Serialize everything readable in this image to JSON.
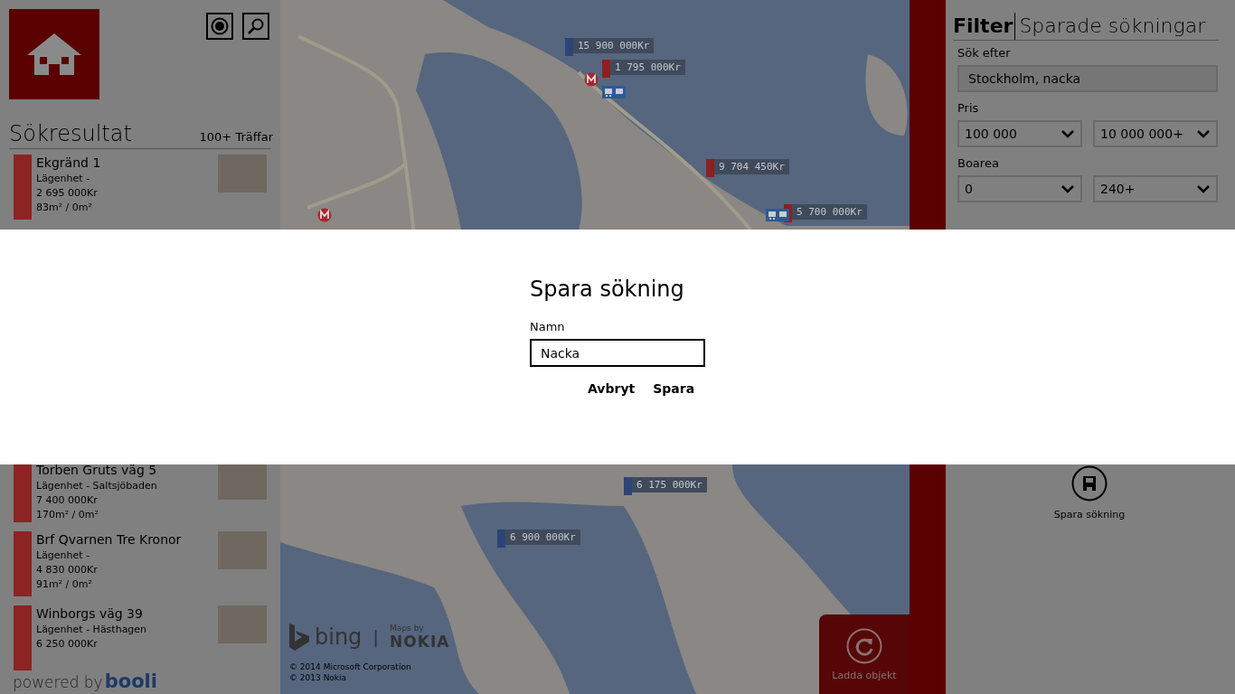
{
  "header": {
    "section_title": "Sökresultat",
    "hit_count": "100+ Träffar"
  },
  "results": [
    {
      "title": "Ekgränd 1",
      "type": "Lägenhet -",
      "price": "2 695 000Kr",
      "area": "83m² / 0m²"
    },
    {
      "title": "Torben Gruts väg 5",
      "type": "Lägenhet - Saltsjöbaden",
      "price": "7 400 000Kr",
      "area": "170m² / 0m²"
    },
    {
      "title": "Brf Qvarnen Tre Kronor",
      "type": "Lägenhet -",
      "price": "4 830 000Kr",
      "area": "91m² / 0m²"
    },
    {
      "title": "Winborgs väg 39",
      "type": "Lägenhet - Hästhagen",
      "price": "6 250 000Kr"
    }
  ],
  "footer": {
    "powered_by": "powered by",
    "brand": "booli"
  },
  "map": {
    "pins": [
      {
        "price": "15 900 000Kr",
        "color": "#2c4576"
      },
      {
        "price": "1 795 000Kr",
        "color": "#8c2020"
      },
      {
        "price": "9 704 450Kr",
        "color": "#8c2020"
      },
      {
        "price": "5 700 000Kr",
        "color": "#8c2020"
      },
      {
        "price": "6 175 000Kr",
        "color": "#2c4576"
      },
      {
        "price": "6 900 000Kr",
        "color": "#2c4576"
      }
    ],
    "logo": "bing",
    "separator": "|",
    "maps_by": "Maps by",
    "provider": "NOKIA",
    "copyright": [
      "© 2014 Microsoft Corporation",
      "© 2013 Nokia"
    ]
  },
  "load_button": {
    "label": "Ladda objekt"
  },
  "filter_panel": {
    "tabs": [
      {
        "label": "Filter",
        "selected": true
      },
      {
        "label": "Sparade sökningar",
        "selected": false
      }
    ],
    "search": {
      "label": "Sök efter",
      "value": "Stockholm, nacka"
    },
    "price": {
      "label": "Pris",
      "min": "100 000",
      "max": "10 000 000+"
    },
    "area": {
      "label": "Boarea",
      "min": "0",
      "max": "240+"
    },
    "save_button": {
      "label": "Spara sökning"
    }
  },
  "dialog": {
    "title": "Spara sökning",
    "field_label": "Namn",
    "value": "Nacka",
    "buttons": [
      "Avbryt",
      "Spara"
    ]
  }
}
